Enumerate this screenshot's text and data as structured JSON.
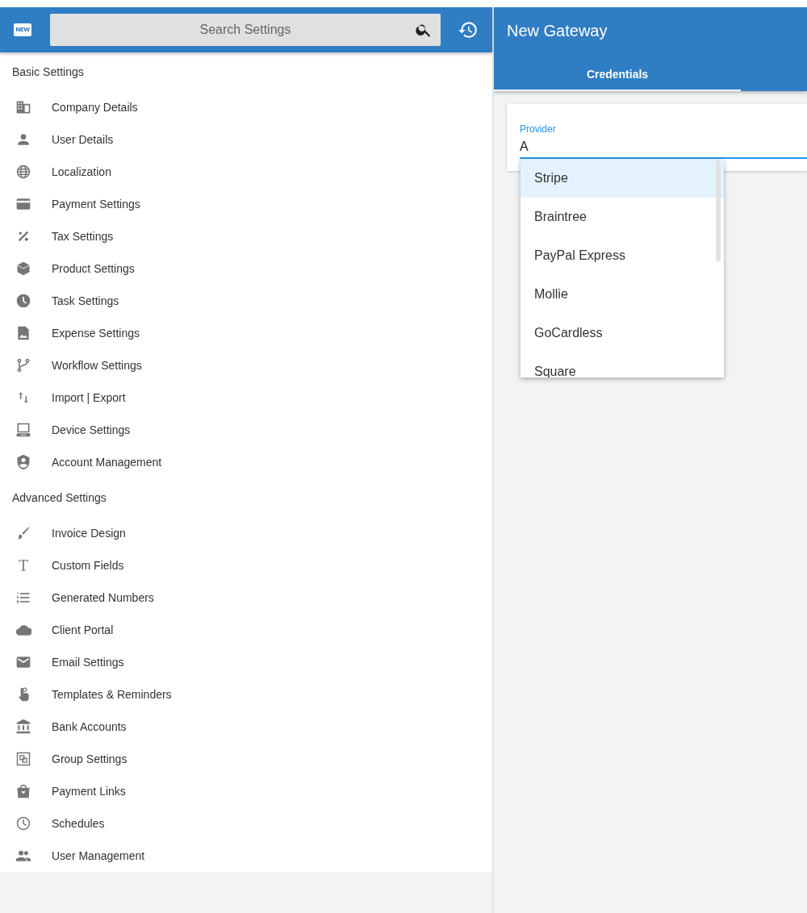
{
  "header": {
    "logo_text": "NEW",
    "search": {
      "placeholder": "Search Settings"
    }
  },
  "sections": [
    {
      "title": "Basic Settings",
      "items": [
        {
          "label": "Company Details"
        },
        {
          "label": "User Details"
        },
        {
          "label": "Localization"
        },
        {
          "label": "Payment Settings"
        },
        {
          "label": "Tax Settings"
        },
        {
          "label": "Product Settings"
        },
        {
          "label": "Task Settings"
        },
        {
          "label": "Expense Settings"
        },
        {
          "label": "Workflow Settings"
        },
        {
          "label": "Import | Export"
        },
        {
          "label": "Device Settings"
        },
        {
          "label": "Account Management"
        }
      ]
    },
    {
      "title": "Advanced Settings",
      "items": [
        {
          "label": "Invoice Design"
        },
        {
          "label": "Custom Fields"
        },
        {
          "label": "Generated Numbers"
        },
        {
          "label": "Client Portal"
        },
        {
          "label": "Email Settings"
        },
        {
          "label": "Templates & Reminders"
        },
        {
          "label": "Bank Accounts"
        },
        {
          "label": "Group Settings"
        },
        {
          "label": "Payment Links"
        },
        {
          "label": "Schedules"
        },
        {
          "label": "User Management"
        }
      ]
    }
  ],
  "panel": {
    "title": "New Gateway",
    "tabs": [
      {
        "label": "Credentials",
        "selected": true
      }
    ],
    "provider": {
      "label": "Provider",
      "value": "A"
    },
    "options": [
      {
        "label": "Stripe",
        "highlighted": true
      },
      {
        "label": "Braintree",
        "highlighted": false
      },
      {
        "label": "PayPal Express",
        "highlighted": false
      },
      {
        "label": "Mollie",
        "highlighted": false
      },
      {
        "label": "GoCardless",
        "highlighted": false
      },
      {
        "label": "Square",
        "highlighted": false
      }
    ]
  }
}
